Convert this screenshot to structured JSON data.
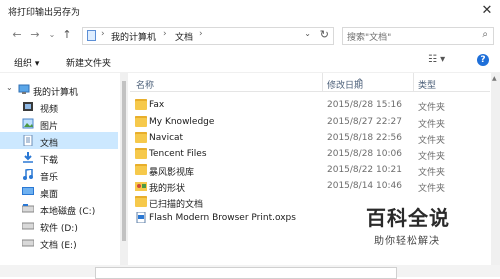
{
  "window": {
    "title": "将打印输出另存为",
    "close_glyph": "✕"
  },
  "nav": {
    "back_glyph": "←",
    "forward_glyph": "→",
    "recent_glyph": "⌄",
    "up_glyph": "↑",
    "breadcrumb": [
      "我的计算机",
      "文档"
    ],
    "breadcrumb_sep": "›",
    "dropdown_glyph": "⌄",
    "refresh_glyph": "↻",
    "search_placeholder": "搜索\"文档\"",
    "search_glyph": "⌕"
  },
  "toolbar": {
    "organize_label": "组织 ▾",
    "new_folder_label": "新建文件夹",
    "view_glyph": "☷ ▾",
    "help_glyph": "?"
  },
  "sidebar": {
    "items": [
      {
        "label": "我的计算机",
        "icon": "pc-icon",
        "expander": "⌄"
      },
      {
        "label": "视频",
        "icon": "video-icon"
      },
      {
        "label": "图片",
        "icon": "picture-icon"
      },
      {
        "label": "文档",
        "icon": "document-icon",
        "selected": true
      },
      {
        "label": "下载",
        "icon": "download-icon"
      },
      {
        "label": "音乐",
        "icon": "music-icon"
      },
      {
        "label": "桌面",
        "icon": "desktop-icon"
      },
      {
        "label": "本地磁盘 (C:)",
        "icon": "drive-icon"
      },
      {
        "label": "软件 (D:)",
        "icon": "drive-icon"
      },
      {
        "label": "文档 (E:)",
        "icon": "drive-icon"
      }
    ]
  },
  "columns": {
    "name": "名称",
    "date": "修改日期",
    "type": "类型",
    "sort_glyph": "^"
  },
  "files": [
    {
      "name": "Fax",
      "date": "2015/8/28 15:16",
      "type": "文件夹",
      "icon": "folder-icon"
    },
    {
      "name": "My Knowledge",
      "date": "2015/8/27 22:27",
      "type": "文件夹",
      "icon": "folder-icon"
    },
    {
      "name": "Navicat",
      "date": "2015/8/18 22:56",
      "type": "文件夹",
      "icon": "folder-icon"
    },
    {
      "name": "Tencent Files",
      "date": "2015/8/28 10:06",
      "type": "文件夹",
      "icon": "folder-icon"
    },
    {
      "name": "暴风影视库",
      "date": "2015/8/22 10:21",
      "type": "文件夹",
      "icon": "folder-icon"
    },
    {
      "name": "我的形状",
      "date": "2015/8/14 10:46",
      "type": "文件夹",
      "icon": "shapes-folder-icon"
    },
    {
      "name": "已扫描的文档",
      "date": "",
      "type": "",
      "icon": "folder-icon"
    },
    {
      "name": "Flash Modern Browser Print.oxps",
      "date": "",
      "type": "",
      "icon": "oxps-file-icon"
    }
  ],
  "watermark": {
    "title": "百科全说",
    "subtitle": "助你轻松解决"
  },
  "colors": {
    "selection": "#cce8ff",
    "folder": "#f6c94b",
    "accent": "#1e6fd9"
  }
}
